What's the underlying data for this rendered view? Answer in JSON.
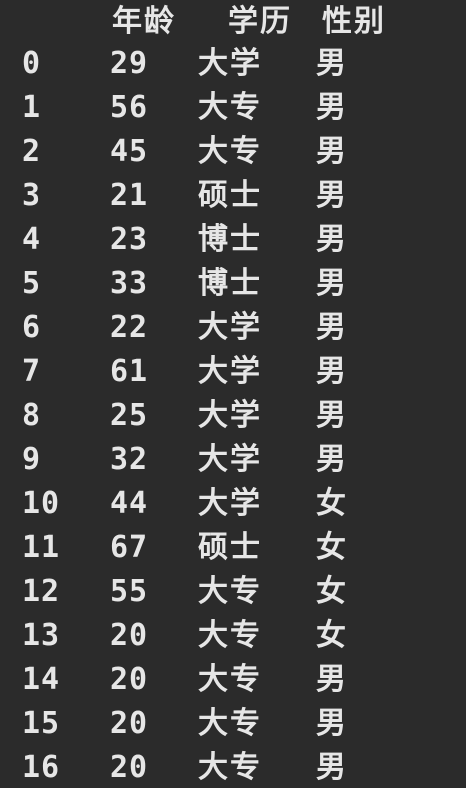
{
  "columns": {
    "age": "年龄",
    "education": "学历",
    "gender": "性别"
  },
  "rows": [
    {
      "index": "0",
      "age": "29",
      "education": "大学",
      "gender": "男"
    },
    {
      "index": "1",
      "age": "56",
      "education": "大专",
      "gender": "男"
    },
    {
      "index": "2",
      "age": "45",
      "education": "大专",
      "gender": "男"
    },
    {
      "index": "3",
      "age": "21",
      "education": "硕士",
      "gender": "男"
    },
    {
      "index": "4",
      "age": "23",
      "education": "博士",
      "gender": "男"
    },
    {
      "index": "5",
      "age": "33",
      "education": "博士",
      "gender": "男"
    },
    {
      "index": "6",
      "age": "22",
      "education": "大学",
      "gender": "男"
    },
    {
      "index": "7",
      "age": "61",
      "education": "大学",
      "gender": "男"
    },
    {
      "index": "8",
      "age": "25",
      "education": "大学",
      "gender": "男"
    },
    {
      "index": "9",
      "age": "32",
      "education": "大学",
      "gender": "男"
    },
    {
      "index": "10",
      "age": "44",
      "education": "大学",
      "gender": "女"
    },
    {
      "index": "11",
      "age": "67",
      "education": "硕士",
      "gender": "女"
    },
    {
      "index": "12",
      "age": "55",
      "education": "大专",
      "gender": "女"
    },
    {
      "index": "13",
      "age": "20",
      "education": "大专",
      "gender": "女"
    },
    {
      "index": "14",
      "age": "20",
      "education": "大专",
      "gender": "男"
    },
    {
      "index": "15",
      "age": "20",
      "education": "大专",
      "gender": "男"
    },
    {
      "index": "16",
      "age": "20",
      "education": "大专",
      "gender": "男"
    }
  ]
}
